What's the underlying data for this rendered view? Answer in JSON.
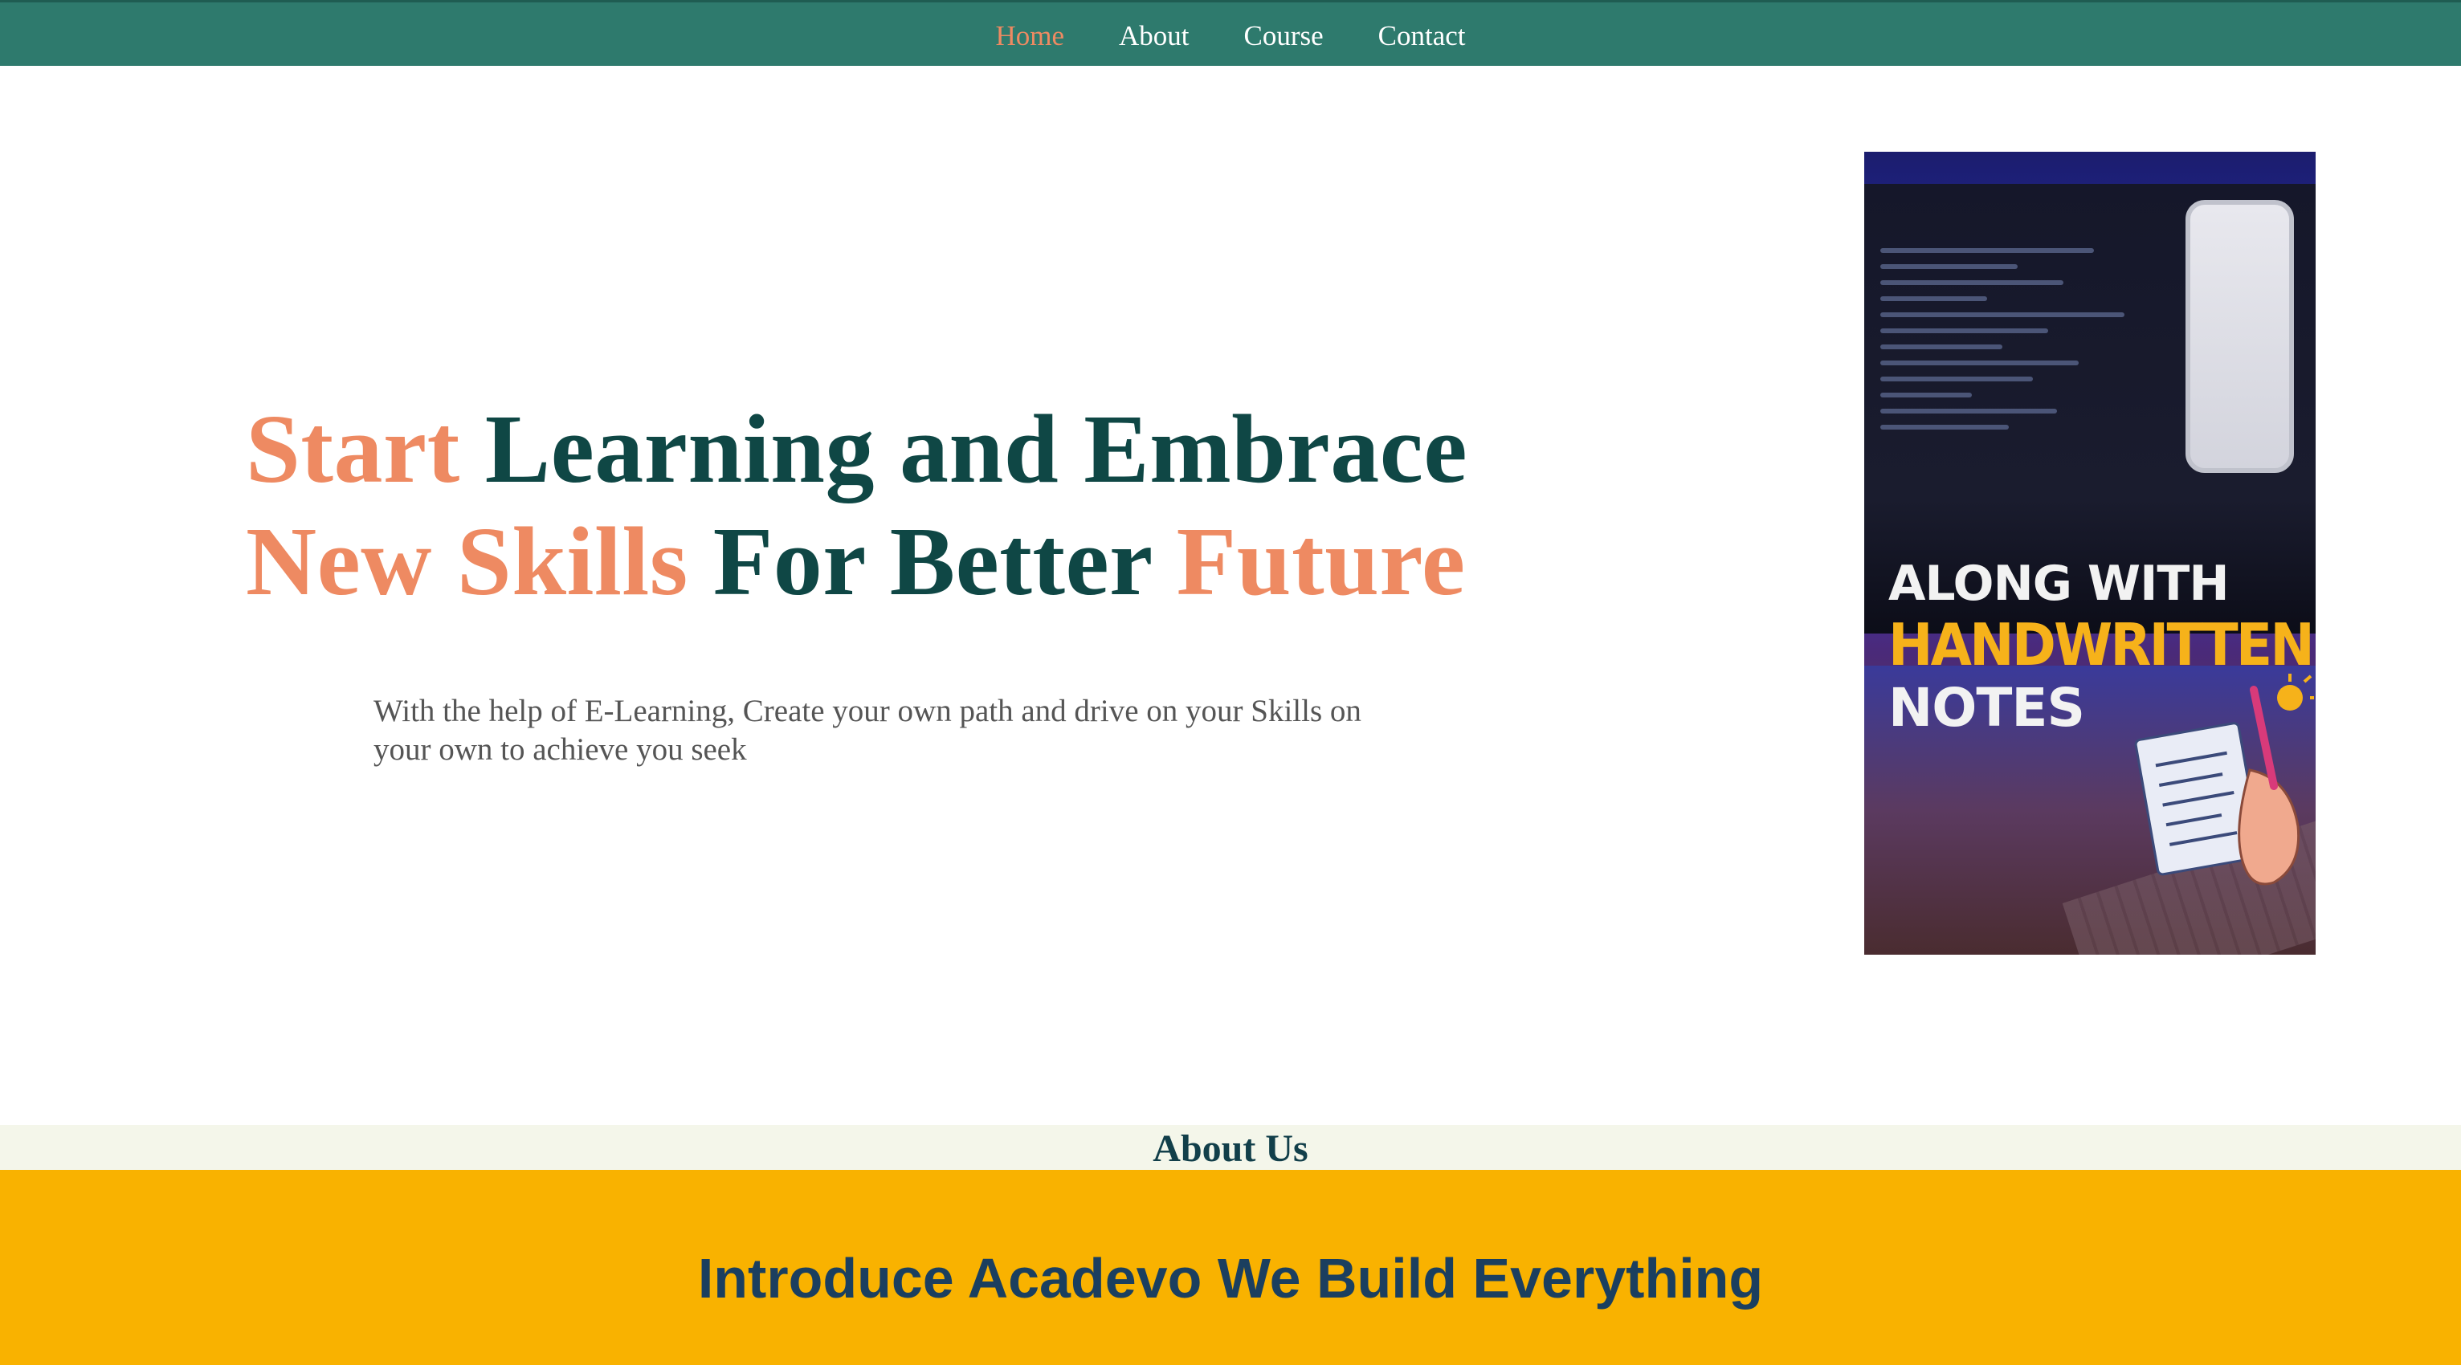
{
  "nav": {
    "items": [
      {
        "label": "Home",
        "active": true
      },
      {
        "label": "About",
        "active": false
      },
      {
        "label": "Course",
        "active": false
      },
      {
        "label": "Contact",
        "active": false
      }
    ]
  },
  "hero": {
    "title_parts": [
      "Start",
      " Learning and Embrace",
      "New Skills",
      " For Better ",
      "Future"
    ],
    "description": "With the help of E-Learning, Create your own path and drive on your Skills on your own to achieve you seek"
  },
  "promo": {
    "line1": "ALONG WITH",
    "line2": "HANDWRITTEN",
    "line3": "NOTES"
  },
  "about": {
    "heading": "About Us"
  },
  "intro": {
    "heading": "Introduce Acadevo We Build Everything"
  },
  "colors": {
    "nav_bg": "#2e7a6d",
    "accent": "#ee8a62",
    "title_dark": "#0f4745",
    "section_yellow": "#f9b200",
    "intro_text": "#1b3f5f"
  },
  "icons": {
    "promo_decoration": "notes-hand-icon"
  }
}
